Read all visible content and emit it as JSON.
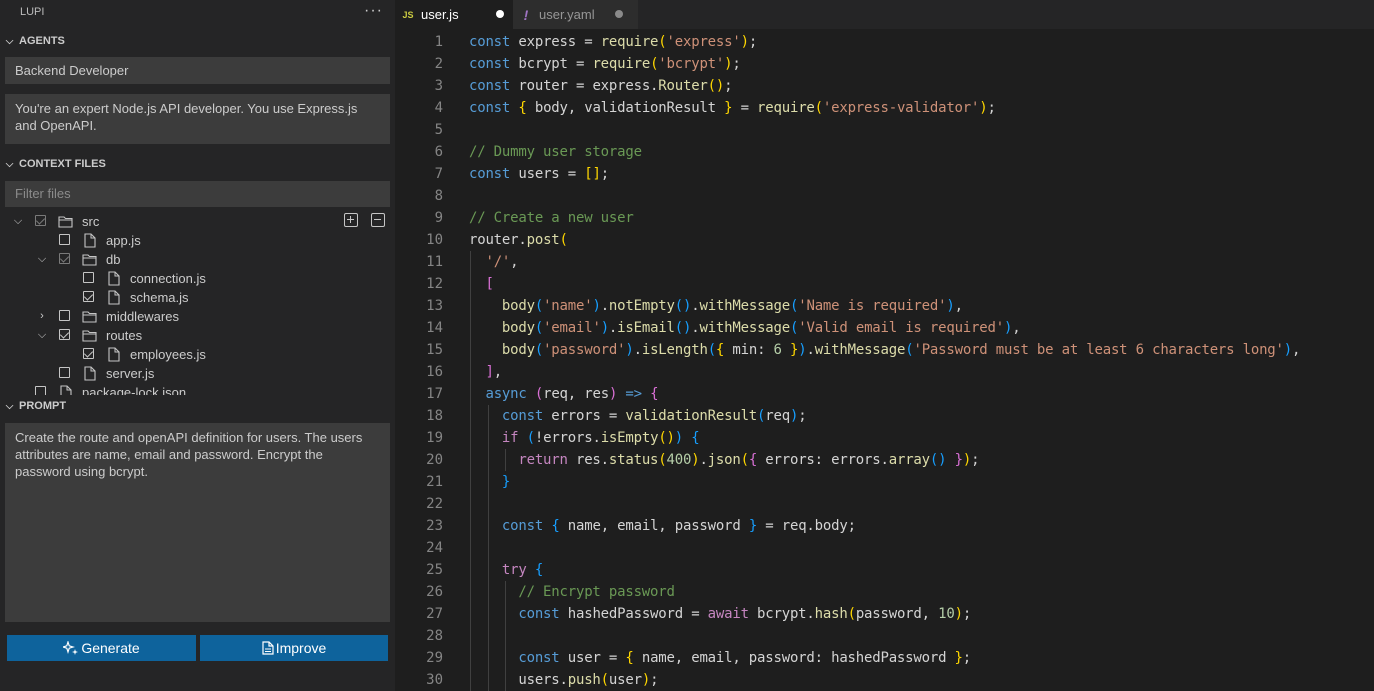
{
  "sidebar": {
    "title": "LUPI",
    "more_label": "···",
    "agents": {
      "title": "AGENTS",
      "selected_agent": "Backend Developer",
      "description": "You're an expert Node.js API developer. You use Express.js and OpenAPI."
    },
    "context_files": {
      "title": "CONTEXT FILES",
      "filter_placeholder": "Filter files",
      "tree": [
        {
          "label": "src",
          "type": "folder",
          "depth": 0,
          "expanded": true,
          "state": "partial"
        },
        {
          "label": "app.js",
          "type": "file",
          "depth": 1,
          "state": "unchecked"
        },
        {
          "label": "db",
          "type": "folder",
          "depth": 1,
          "expanded": true,
          "state": "partial"
        },
        {
          "label": "connection.js",
          "type": "file",
          "depth": 2,
          "state": "unchecked"
        },
        {
          "label": "schema.js",
          "type": "file",
          "depth": 2,
          "state": "checked"
        },
        {
          "label": "middlewares",
          "type": "folder",
          "depth": 1,
          "expanded": false,
          "state": "unchecked"
        },
        {
          "label": "routes",
          "type": "folder",
          "depth": 1,
          "expanded": true,
          "state": "checked"
        },
        {
          "label": "employees.js",
          "type": "file",
          "depth": 2,
          "state": "checked"
        },
        {
          "label": "server.js",
          "type": "file",
          "depth": 1,
          "state": "unchecked"
        },
        {
          "label": "package-lock.json",
          "type": "file",
          "depth": 0,
          "state": "unchecked"
        }
      ]
    },
    "prompt": {
      "title": "PROMPT",
      "text": "Create the route and openAPI definition for users. The users attributes are name, email and password. Encrypt the password using bcrypt."
    },
    "buttons": {
      "generate_label": "Generate",
      "improve_label": "Improve"
    }
  },
  "tabs": [
    {
      "label": "user.js",
      "icon": "JS",
      "active": true,
      "modified": true
    },
    {
      "label": "user.yaml",
      "icon": "!",
      "active": false,
      "modified": true
    }
  ],
  "editor": {
    "lines": [
      [
        [
          "k",
          "const"
        ],
        [
          "t",
          " express = "
        ],
        [
          "f",
          "require"
        ],
        [
          "y",
          "("
        ],
        [
          "s",
          "'express'"
        ],
        [
          "y",
          ")"
        ],
        [
          "t",
          ";"
        ]
      ],
      [
        [
          "k",
          "const"
        ],
        [
          "t",
          " bcrypt = "
        ],
        [
          "f",
          "require"
        ],
        [
          "y",
          "("
        ],
        [
          "s",
          "'bcrypt'"
        ],
        [
          "y",
          ")"
        ],
        [
          "t",
          ";"
        ]
      ],
      [
        [
          "k",
          "const"
        ],
        [
          "t",
          " router = express."
        ],
        [
          "f",
          "Router"
        ],
        [
          "y",
          "()"
        ],
        [
          "t",
          ";"
        ]
      ],
      [
        [
          "k",
          "const"
        ],
        [
          "t",
          " "
        ],
        [
          "y",
          "{"
        ],
        [
          "t",
          " body, validationResult "
        ],
        [
          "y",
          "}"
        ],
        [
          "t",
          " = "
        ],
        [
          "f",
          "require"
        ],
        [
          "y",
          "("
        ],
        [
          "s",
          "'express-validator'"
        ],
        [
          "y",
          ")"
        ],
        [
          "t",
          ";"
        ]
      ],
      [],
      [
        [
          "cm",
          "// Dummy user storage"
        ]
      ],
      [
        [
          "k",
          "const"
        ],
        [
          "t",
          " users = "
        ],
        [
          "y",
          "[]"
        ],
        [
          "t",
          ";"
        ]
      ],
      [],
      [
        [
          "cm",
          "// Create a new user"
        ]
      ],
      [
        [
          "t",
          "router."
        ],
        [
          "f",
          "post"
        ],
        [
          "y",
          "("
        ]
      ],
      [
        [
          "t",
          "  "
        ],
        [
          "s",
          "'/'"
        ],
        [
          "t",
          ","
        ]
      ],
      [
        [
          "t",
          "  "
        ],
        [
          "p",
          "["
        ]
      ],
      [
        [
          "t",
          "    "
        ],
        [
          "f",
          "body"
        ],
        [
          "b",
          "("
        ],
        [
          "s",
          "'name'"
        ],
        [
          "b",
          ")"
        ],
        [
          "t",
          "."
        ],
        [
          "f",
          "notEmpty"
        ],
        [
          "b",
          "()"
        ],
        [
          "t",
          "."
        ],
        [
          "f",
          "withMessage"
        ],
        [
          "b",
          "("
        ],
        [
          "s",
          "'Name is required'"
        ],
        [
          "b",
          ")"
        ],
        [
          "t",
          ","
        ]
      ],
      [
        [
          "t",
          "    "
        ],
        [
          "f",
          "body"
        ],
        [
          "b",
          "("
        ],
        [
          "s",
          "'email'"
        ],
        [
          "b",
          ")"
        ],
        [
          "t",
          "."
        ],
        [
          "f",
          "isEmail"
        ],
        [
          "b",
          "()"
        ],
        [
          "t",
          "."
        ],
        [
          "f",
          "withMessage"
        ],
        [
          "b",
          "("
        ],
        [
          "s",
          "'Valid email is required'"
        ],
        [
          "b",
          ")"
        ],
        [
          "t",
          ","
        ]
      ],
      [
        [
          "t",
          "    "
        ],
        [
          "f",
          "body"
        ],
        [
          "b",
          "("
        ],
        [
          "s",
          "'password'"
        ],
        [
          "b",
          ")"
        ],
        [
          "t",
          "."
        ],
        [
          "f",
          "isLength"
        ],
        [
          "b",
          "("
        ],
        [
          "y",
          "{"
        ],
        [
          "t",
          " min: "
        ],
        [
          "n",
          "6"
        ],
        [
          "t",
          " "
        ],
        [
          "y",
          "}"
        ],
        [
          "b",
          ")"
        ],
        [
          "t",
          "."
        ],
        [
          "f",
          "withMessage"
        ],
        [
          "b",
          "("
        ],
        [
          "s",
          "'Password must be at least 6 characters long'"
        ],
        [
          "b",
          ")"
        ],
        [
          "t",
          ","
        ]
      ],
      [
        [
          "t",
          "  "
        ],
        [
          "p",
          "]"
        ],
        [
          "t",
          ","
        ]
      ],
      [
        [
          "t",
          "  "
        ],
        [
          "k",
          "async"
        ],
        [
          "t",
          " "
        ],
        [
          "p",
          "("
        ],
        [
          "t",
          "req, res"
        ],
        [
          "p",
          ")"
        ],
        [
          "t",
          " "
        ],
        [
          "k",
          "=>"
        ],
        [
          "t",
          " "
        ],
        [
          "p",
          "{"
        ]
      ],
      [
        [
          "t",
          "    "
        ],
        [
          "k",
          "const"
        ],
        [
          "t",
          " errors = "
        ],
        [
          "f",
          "validationResult"
        ],
        [
          "b",
          "("
        ],
        [
          "t",
          "req"
        ],
        [
          "b",
          ")"
        ],
        [
          "t",
          ";"
        ]
      ],
      [
        [
          "t",
          "    "
        ],
        [
          "c",
          "if"
        ],
        [
          "t",
          " "
        ],
        [
          "b",
          "("
        ],
        [
          "t",
          "!errors."
        ],
        [
          "f",
          "isEmpty"
        ],
        [
          "y",
          "()"
        ],
        [
          "b",
          ")"
        ],
        [
          "t",
          " "
        ],
        [
          "b",
          "{"
        ]
      ],
      [
        [
          "t",
          "      "
        ],
        [
          "c",
          "return"
        ],
        [
          "t",
          " res."
        ],
        [
          "f",
          "status"
        ],
        [
          "y",
          "("
        ],
        [
          "n",
          "400"
        ],
        [
          "y",
          ")"
        ],
        [
          "t",
          "."
        ],
        [
          "f",
          "json"
        ],
        [
          "y",
          "("
        ],
        [
          "p",
          "{"
        ],
        [
          "t",
          " errors: errors."
        ],
        [
          "f",
          "array"
        ],
        [
          "b",
          "()"
        ],
        [
          "t",
          " "
        ],
        [
          "p",
          "}"
        ],
        [
          "y",
          ")"
        ],
        [
          "t",
          ";"
        ]
      ],
      [
        [
          "t",
          "    "
        ],
        [
          "b",
          "}"
        ]
      ],
      [],
      [
        [
          "t",
          "    "
        ],
        [
          "k",
          "const"
        ],
        [
          "t",
          " "
        ],
        [
          "b",
          "{"
        ],
        [
          "t",
          " name, email, password "
        ],
        [
          "b",
          "}"
        ],
        [
          "t",
          " = req.body;"
        ]
      ],
      [],
      [
        [
          "t",
          "    "
        ],
        [
          "c",
          "try"
        ],
        [
          "t",
          " "
        ],
        [
          "b",
          "{"
        ]
      ],
      [
        [
          "t",
          "      "
        ],
        [
          "cm",
          "// Encrypt password"
        ]
      ],
      [
        [
          "t",
          "      "
        ],
        [
          "k",
          "const"
        ],
        [
          "t",
          " hashedPassword = "
        ],
        [
          "c",
          "await"
        ],
        [
          "t",
          " bcrypt."
        ],
        [
          "f",
          "hash"
        ],
        [
          "y",
          "("
        ],
        [
          "t",
          "password, "
        ],
        [
          "n",
          "10"
        ],
        [
          "y",
          ")"
        ],
        [
          "t",
          ";"
        ]
      ],
      [],
      [
        [
          "t",
          "      "
        ],
        [
          "k",
          "const"
        ],
        [
          "t",
          " user = "
        ],
        [
          "y",
          "{"
        ],
        [
          "t",
          " name, email, password: hashedPassword "
        ],
        [
          "y",
          "}"
        ],
        [
          "t",
          ";"
        ]
      ],
      [
        [
          "t",
          "      users."
        ],
        [
          "f",
          "push"
        ],
        [
          "y",
          "("
        ],
        [
          "t",
          "user"
        ],
        [
          "y",
          ")"
        ],
        [
          "t",
          ";"
        ]
      ]
    ]
  }
}
